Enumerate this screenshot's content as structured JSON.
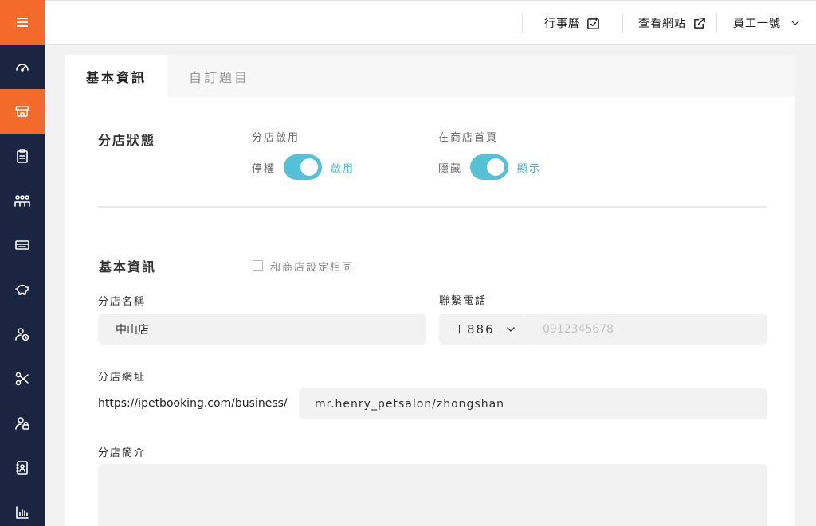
{
  "topbar": {
    "calendar_label": "行事曆",
    "view_site_label": "查看網站",
    "user_label": "員工一號"
  },
  "sidebar": {
    "items": [
      {
        "icon": "dashboard-icon"
      },
      {
        "icon": "store-icon",
        "active": true
      },
      {
        "icon": "clipboard-icon"
      },
      {
        "icon": "staff-group-icon"
      },
      {
        "icon": "ticket-icon"
      },
      {
        "icon": "piggy-bank-icon"
      },
      {
        "icon": "user-clock-icon"
      },
      {
        "icon": "scissors-icon"
      },
      {
        "icon": "user-lock-icon"
      },
      {
        "icon": "contact-book-icon"
      },
      {
        "icon": "bar-chart-icon"
      }
    ],
    "accent_color": "#f26b2a",
    "background_color": "#1b2440"
  },
  "tabs": [
    {
      "label": "基本資訊",
      "active": true
    },
    {
      "label": "自訂題目",
      "active": false
    }
  ],
  "branch_status": {
    "title": "分店狀態",
    "enable": {
      "label": "分店啟用",
      "off_label": "停權",
      "on_label": "啟用",
      "value": true
    },
    "homepage": {
      "label": "在商店首頁",
      "off_label": "隱藏",
      "on_label": "顯示",
      "value": true
    },
    "toggle_color": "#56c1d4"
  },
  "basic_info": {
    "title": "基本資訊",
    "same_as_store_label": "和商店設定相同",
    "same_as_store_checked": false,
    "name": {
      "label": "分店名稱",
      "value": "中山店"
    },
    "phone": {
      "label": "聯繫電話",
      "country_code": "＋886",
      "placeholder": "0912345678"
    },
    "url": {
      "label": "分店網址",
      "prefix": "https://ipetbooking.com/business/",
      "value": "mr.henry_petsalon/zhongshan"
    },
    "intro": {
      "label": "分店簡介",
      "value": ""
    }
  }
}
